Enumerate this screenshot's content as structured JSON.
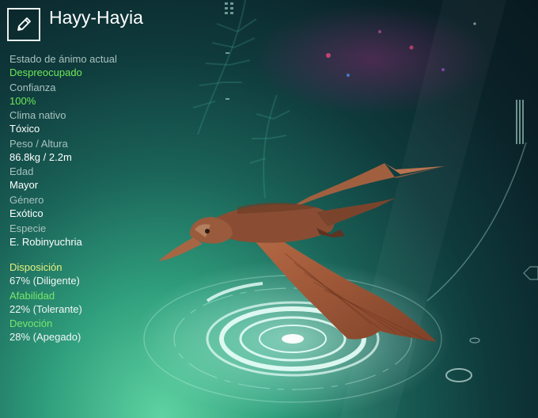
{
  "header": {
    "edit_icon": "pencil-icon",
    "name": "Hayy-Hayia"
  },
  "stats": [
    {
      "key": "mood",
      "label": "Estado de ánimo actual",
      "value": "Despreocupado",
      "value_color": "#6de85a"
    },
    {
      "key": "trust",
      "label": "Confianza",
      "value": "100%",
      "value_color": "#6de85a"
    },
    {
      "key": "climate",
      "label": "Clima nativo",
      "value": "Tóxico"
    },
    {
      "key": "weight",
      "label": "Peso / Altura",
      "value": "86.8kg / 2.2m"
    },
    {
      "key": "age",
      "label": "Edad",
      "value": "Mayor"
    },
    {
      "key": "gender",
      "label": "Género",
      "value": "Exótico"
    },
    {
      "key": "species",
      "label": "Especie",
      "value": "E. Robinyuchria"
    }
  ],
  "traits": [
    {
      "key": "disposition",
      "label": "Disposición",
      "value": "67% (Diligente)",
      "label_color": "#e8f07a"
    },
    {
      "key": "affability",
      "label": "Afabilidad",
      "value": "22% (Tolerante)",
      "label_color": "#79e86a"
    },
    {
      "key": "devotion",
      "label": "Devoción",
      "value": "28% (Apegado)",
      "label_color": "#79e86a"
    }
  ],
  "colors": {
    "accent_green": "#6de85a",
    "trait_yellow": "#e8f07a",
    "label_grey": "#a8c2bf",
    "background_dark": "#081a1f",
    "background_glow": "#5fd3a2",
    "creature_body": "#9a5b3c"
  },
  "scene": {
    "creature": "flying-reptile-bird",
    "pedestal": "holographic-rings"
  }
}
